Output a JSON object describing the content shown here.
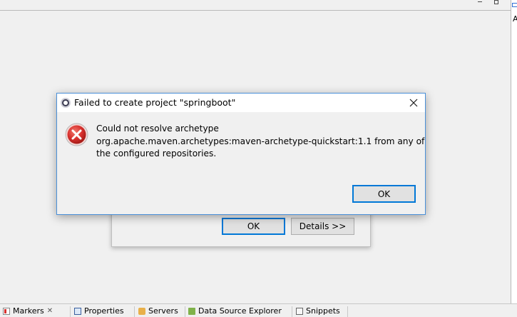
{
  "window_controls": {
    "minimize_icon": "minimize-icon",
    "maximize_icon": "maximize-icon"
  },
  "right_view": {
    "letter": "A"
  },
  "dialog": {
    "title": "Failed to create project \"springboot\"",
    "icon": "error-icon",
    "message_lines": [
      "Could not resolve archetype",
      "org.apache.maven.archetypes:maven-archetype-quickstart:1.1 from any of",
      "the configured repositories."
    ],
    "ok_label": "OK",
    "close_icon": "close-icon"
  },
  "background_dialog": {
    "ok_label": "OK",
    "details_label": "Details >>"
  },
  "bottom_tabs": [
    {
      "label": "Markers",
      "icon": "markers-icon",
      "closable": true
    },
    {
      "label": "Properties",
      "icon": "properties-icon"
    },
    {
      "label": "Servers",
      "icon": "servers-icon"
    },
    {
      "label": "Data Source Explorer",
      "icon": "data-source-icon"
    },
    {
      "label": "Snippets",
      "icon": "snippets-icon"
    }
  ],
  "colors": {
    "accent": "#0078d7",
    "error_red": "#d8302d",
    "dialog_border": "#4a90d9"
  }
}
